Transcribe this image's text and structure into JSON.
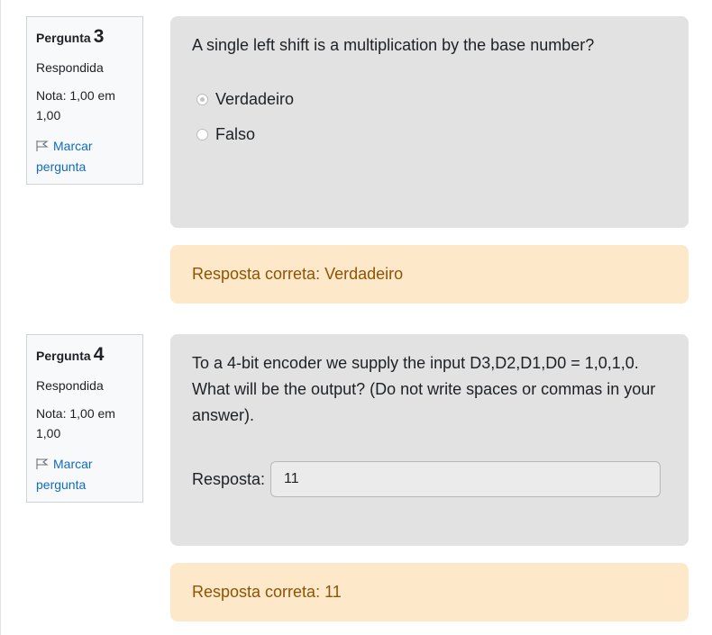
{
  "questions": [
    {
      "label": "Pergunta",
      "number": "3",
      "state": "Respondida",
      "grade": "Nota: 1,00 em 1,00",
      "flag_label": "Marcar pergunta",
      "text": "A single left shift is a multiplication by the base number?",
      "options": [
        {
          "label": "Verdadeiro",
          "selected": true
        },
        {
          "label": "Falso",
          "selected": false
        }
      ],
      "feedback": "Resposta correta: Verdadeiro"
    },
    {
      "label": "Pergunta",
      "number": "4",
      "state": "Respondida",
      "grade": "Nota: 1,00 em 1,00",
      "flag_label": "Marcar pergunta",
      "text": "To a 4-bit encoder we supply the input D3,D2,D1,D0 = 1,0,1,0. What will be the output? (Do not write spaces or commas in your answer).",
      "answer_label": "Resposta:",
      "answer_value": "11",
      "feedback": "Resposta correta: 11"
    }
  ],
  "colors": {
    "accent": "#0f6cbf",
    "question_bg": "#e2e2e2",
    "feedback_bg": "#fde8c9",
    "feedback_text": "#8e5303"
  },
  "icons": {
    "flag": "flag-icon"
  }
}
